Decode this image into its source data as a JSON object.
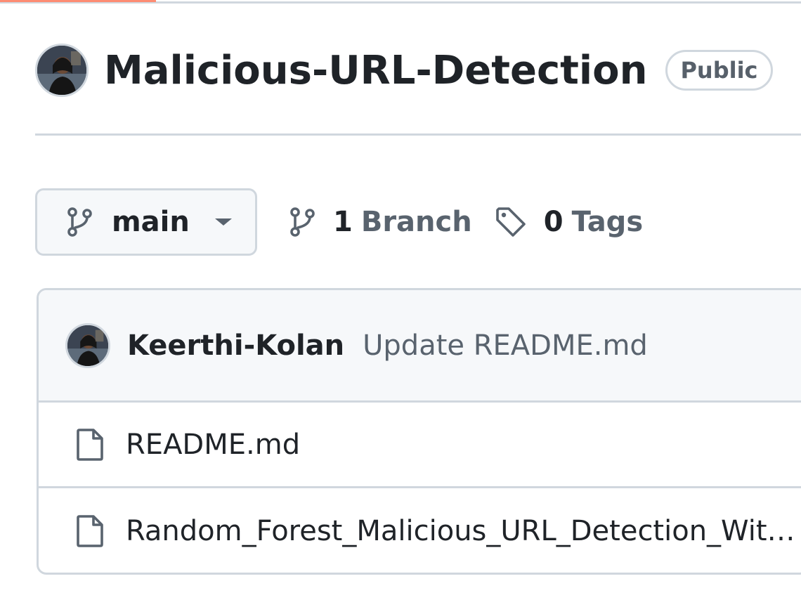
{
  "repo": {
    "name": "Malicious-URL-Detection",
    "visibility": "Public"
  },
  "branch_bar": {
    "current_branch": "main",
    "branch_count": "1",
    "branch_word": "Branch",
    "tag_count": "0",
    "tag_word": "Tags"
  },
  "latest_commit": {
    "author": "Keerthi-Kolan",
    "message": "Update README.md"
  },
  "files": [
    {
      "name": "README.md",
      "icon": "file-icon"
    },
    {
      "name": "Random_Forest_Malicious_URL_Detection_Wit…",
      "icon": "file-icon"
    }
  ],
  "colors": {
    "accent_tab": "#fd8c73",
    "border": "#d0d7de",
    "muted_text": "#59636e",
    "text": "#1f2328",
    "canvas_subtle": "#f6f8fa"
  }
}
